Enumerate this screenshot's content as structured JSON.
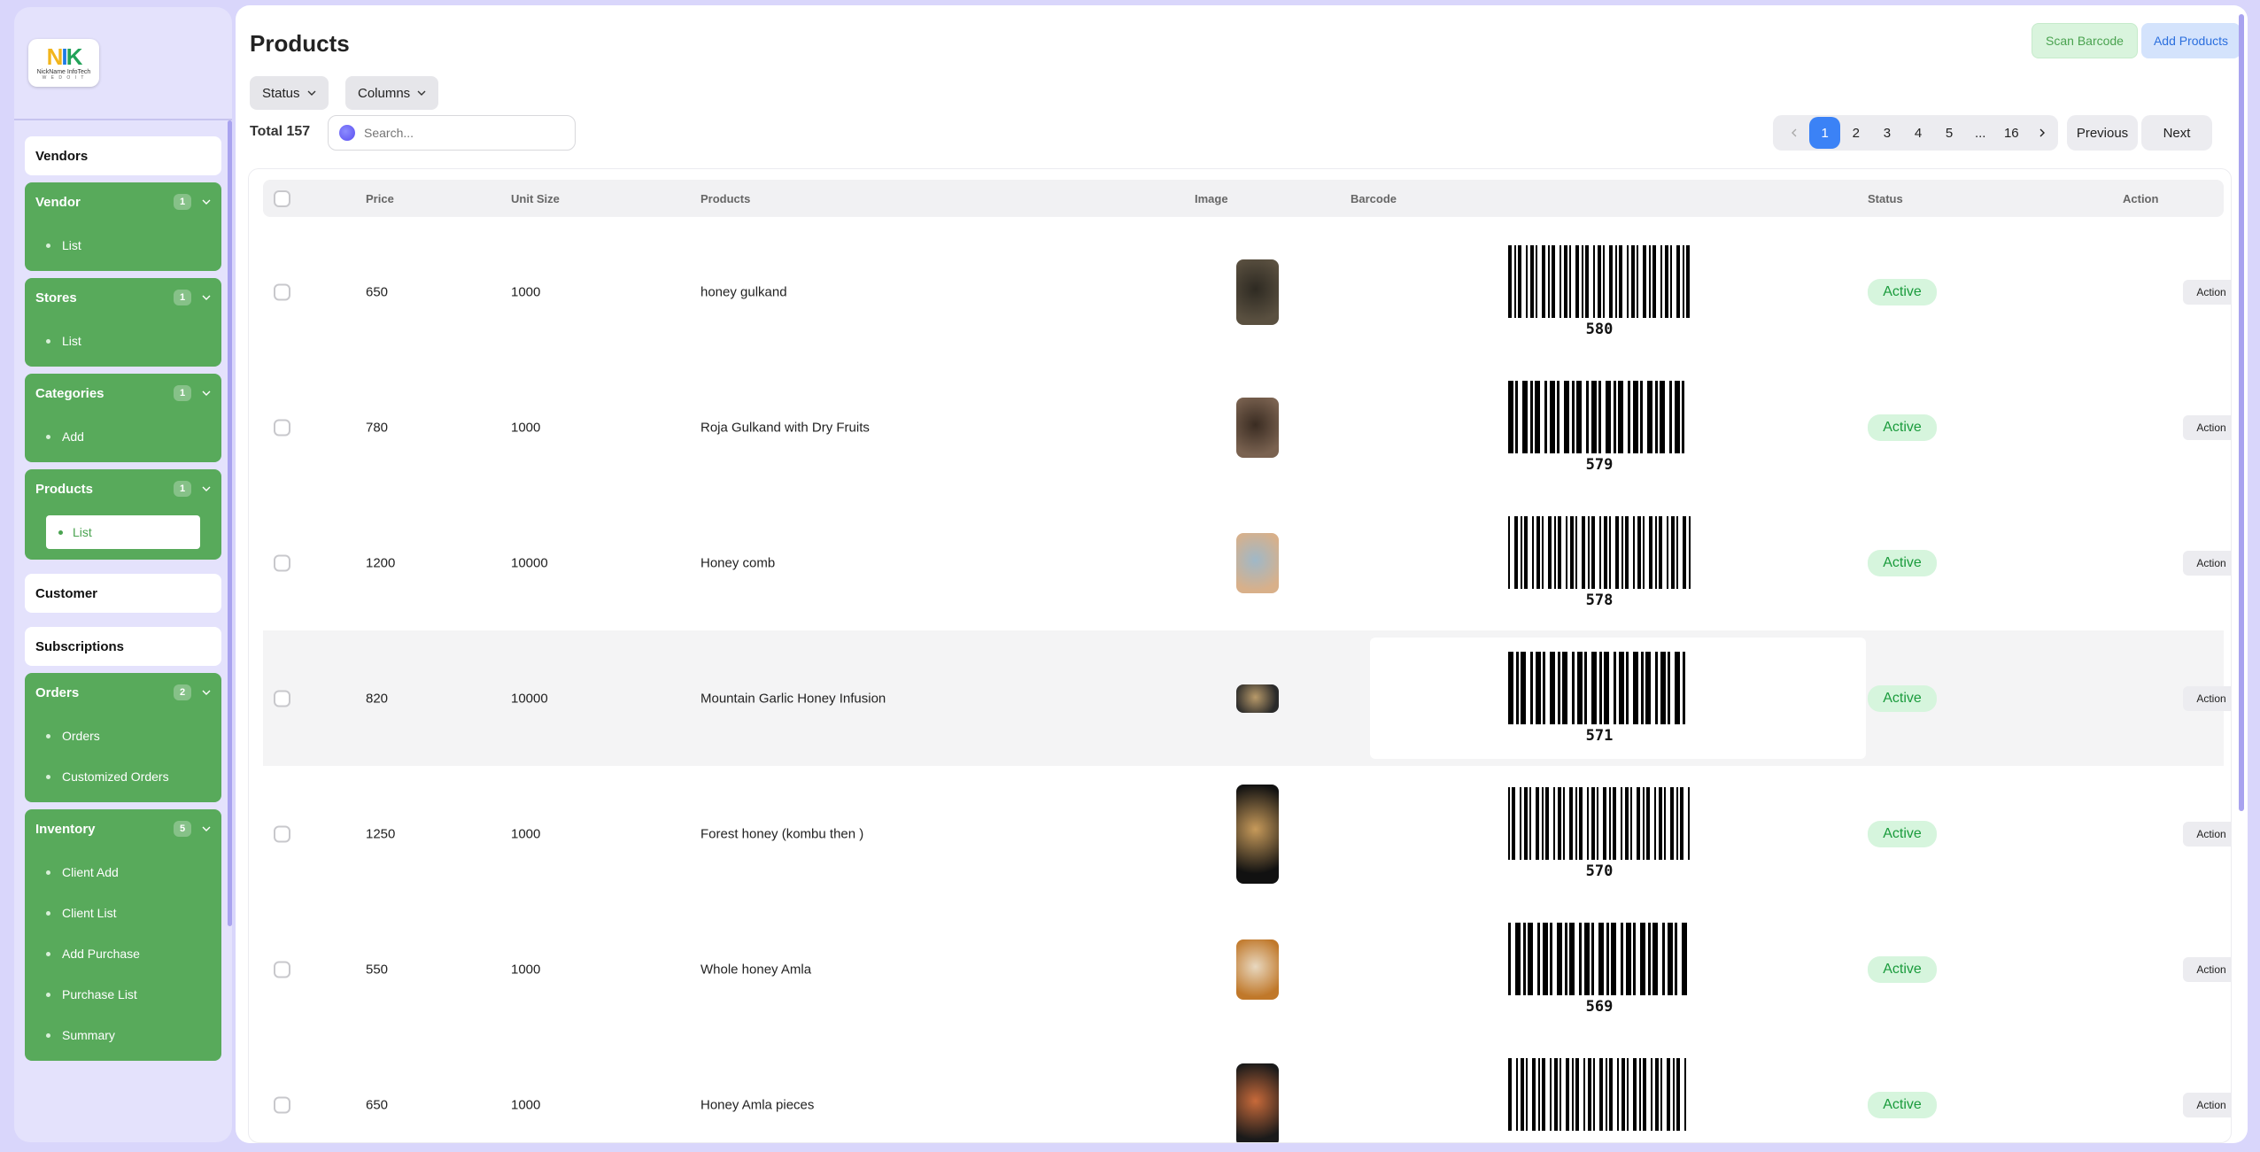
{
  "logo": {
    "text": "NickName InfoTech",
    "sub": "W E  D O  I T"
  },
  "sidebar": {
    "vendors_label": "Vendors",
    "groups": [
      {
        "key": "vendor",
        "label": "Vendor",
        "count": "1",
        "items": [
          {
            "label": "List",
            "active": false
          }
        ]
      },
      {
        "key": "stores",
        "label": "Stores",
        "count": "1",
        "items": [
          {
            "label": "List",
            "active": false
          }
        ]
      },
      {
        "key": "categories",
        "label": "Categories",
        "count": "1",
        "items": [
          {
            "label": "Add",
            "active": false
          }
        ]
      },
      {
        "key": "products",
        "label": "Products",
        "count": "1",
        "items": [
          {
            "label": "List",
            "active": true
          }
        ]
      }
    ],
    "customer_label": "Customer",
    "subscriptions_label": "Subscriptions",
    "groups2": [
      {
        "key": "orders",
        "label": "Orders",
        "count": "2",
        "items": [
          {
            "label": "Orders",
            "active": false
          },
          {
            "label": "Customized Orders",
            "active": false
          }
        ]
      },
      {
        "key": "inventory",
        "label": "Inventory",
        "count": "5",
        "items": [
          {
            "label": "Client Add",
            "active": false
          },
          {
            "label": "Client List",
            "active": false
          },
          {
            "label": "Add Purchase",
            "active": false
          },
          {
            "label": "Purchase List",
            "active": false
          },
          {
            "label": "Summary",
            "active": false
          }
        ]
      }
    ]
  },
  "header": {
    "title": "Products",
    "scan_label": "Scan Barcode",
    "add_label": "Add Products"
  },
  "filters": {
    "status_label": "Status",
    "columns_label": "Columns"
  },
  "total_label": "Total 157",
  "search": {
    "placeholder": "Search..."
  },
  "pagination": {
    "prev_icon": "chevron-left-icon",
    "pages": [
      "1",
      "2",
      "3",
      "4",
      "5",
      "...",
      "16"
    ],
    "current": "1",
    "next_icon": "chevron-right-icon",
    "previous_label": "Previous",
    "next_label": "Next"
  },
  "table": {
    "columns": [
      "Price",
      "Unit Size",
      "Products",
      "Image",
      "Barcode",
      "Status",
      "Action"
    ],
    "rows": [
      {
        "price": "650",
        "unit": "1000",
        "product": "honey gulkand",
        "barcode": "580",
        "status": "Active",
        "action": "Action",
        "img": {
          "h": 74,
          "c1": "#5a5040",
          "c2": "#2e2a22"
        }
      },
      {
        "price": "780",
        "unit": "1000",
        "product": "Roja Gulkand with Dry Fruits",
        "barcode": "579",
        "status": "Active",
        "action": "Action",
        "img": {
          "h": 68,
          "c1": "#7a6250",
          "c2": "#3a2c22"
        }
      },
      {
        "price": "1200",
        "unit": "10000",
        "product": "Honey comb",
        "barcode": "578",
        "status": "Active",
        "action": "Action",
        "img": {
          "h": 68,
          "c1": "#d8b08a",
          "c2": "#9fb8c8"
        }
      },
      {
        "price": "820",
        "unit": "10000",
        "product": "Mountain Garlic Honey Infusion",
        "barcode": "571",
        "status": "Active",
        "action": "Action",
        "img": {
          "h": 32,
          "c1": "#2a2a2a",
          "c2": "#b89a6a"
        }
      },
      {
        "price": "1250",
        "unit": "1000",
        "product": "Forest honey (kombu then )",
        "barcode": "570",
        "status": "Active",
        "action": "Action",
        "img": {
          "h": 112,
          "c1": "#111111",
          "c2": "#c79a5a"
        }
      },
      {
        "price": "550",
        "unit": "1000",
        "product": "Whole honey Amla",
        "barcode": "569",
        "status": "Active",
        "action": "Action",
        "img": {
          "h": 68,
          "c1": "#c0782a",
          "c2": "#e8d8c0"
        }
      },
      {
        "price": "650",
        "unit": "1000",
        "product": "Honey Amla pieces",
        "barcode": "",
        "status": "Active",
        "action": "Action",
        "img": {
          "h": 94,
          "c1": "#1a1a1a",
          "c2": "#c86a3a"
        }
      }
    ]
  }
}
